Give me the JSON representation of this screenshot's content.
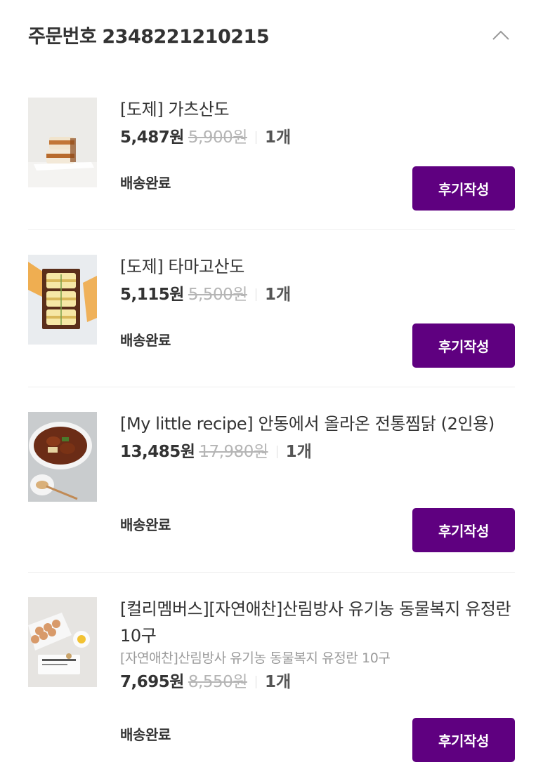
{
  "order": {
    "label": "주문번호",
    "number": "2348221210215"
  },
  "items": [
    {
      "name": "[도제] 가츠산도",
      "option": "",
      "price": "5,487원",
      "original_price": "5,900원",
      "quantity": "1개",
      "status": "배송완료",
      "review_label": "후기작성",
      "thumb": "katsu-sando-photo"
    },
    {
      "name": "[도제] 타마고산도",
      "option": "",
      "price": "5,115원",
      "original_price": "5,500원",
      "quantity": "1개",
      "status": "배송완료",
      "review_label": "후기작성",
      "thumb": "tamago-sando-photo"
    },
    {
      "name": "[My little recipe] 안동에서 올라온 전통찜닭 (2인용)",
      "option": "",
      "price": "13,485원",
      "original_price": "17,980원",
      "quantity": "1개",
      "status": "배송완료",
      "review_label": "후기작성",
      "thumb": "jjimdak-photo"
    },
    {
      "name": "[컬리멤버스][자연애찬]산림방사 유기농 동물복지 유정란 10구",
      "option": "[자연애찬]산림방사 유기농 동물복지 유정란 10구",
      "price": "7,695원",
      "original_price": "8,550원",
      "quantity": "1개",
      "status": "배송완료",
      "review_label": "후기작성",
      "thumb": "eggs-photo"
    }
  ],
  "colors": {
    "accent": "#5f0080",
    "text": "#333333",
    "muted": "#b5b5b5"
  },
  "icons": {
    "collapse": "chevron-up-icon"
  }
}
